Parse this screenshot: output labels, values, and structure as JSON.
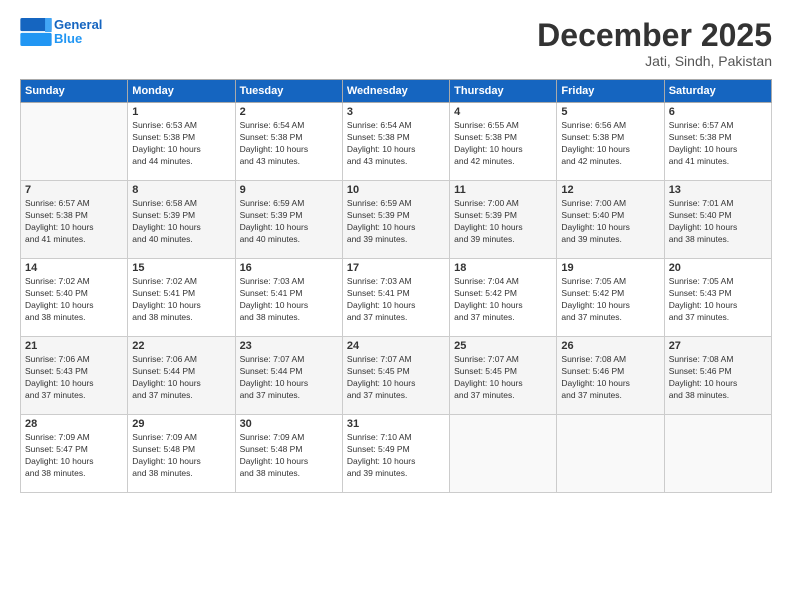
{
  "header": {
    "logo_line1": "General",
    "logo_line2": "Blue",
    "month": "December 2025",
    "location": "Jati, Sindh, Pakistan"
  },
  "weekdays": [
    "Sunday",
    "Monday",
    "Tuesday",
    "Wednesday",
    "Thursday",
    "Friday",
    "Saturday"
  ],
  "weeks": [
    [
      {
        "day": "",
        "info": ""
      },
      {
        "day": "1",
        "info": "Sunrise: 6:53 AM\nSunset: 5:38 PM\nDaylight: 10 hours\nand 44 minutes."
      },
      {
        "day": "2",
        "info": "Sunrise: 6:54 AM\nSunset: 5:38 PM\nDaylight: 10 hours\nand 43 minutes."
      },
      {
        "day": "3",
        "info": "Sunrise: 6:54 AM\nSunset: 5:38 PM\nDaylight: 10 hours\nand 43 minutes."
      },
      {
        "day": "4",
        "info": "Sunrise: 6:55 AM\nSunset: 5:38 PM\nDaylight: 10 hours\nand 42 minutes."
      },
      {
        "day": "5",
        "info": "Sunrise: 6:56 AM\nSunset: 5:38 PM\nDaylight: 10 hours\nand 42 minutes."
      },
      {
        "day": "6",
        "info": "Sunrise: 6:57 AM\nSunset: 5:38 PM\nDaylight: 10 hours\nand 41 minutes."
      }
    ],
    [
      {
        "day": "7",
        "info": "Sunrise: 6:57 AM\nSunset: 5:38 PM\nDaylight: 10 hours\nand 41 minutes."
      },
      {
        "day": "8",
        "info": "Sunrise: 6:58 AM\nSunset: 5:39 PM\nDaylight: 10 hours\nand 40 minutes."
      },
      {
        "day": "9",
        "info": "Sunrise: 6:59 AM\nSunset: 5:39 PM\nDaylight: 10 hours\nand 40 minutes."
      },
      {
        "day": "10",
        "info": "Sunrise: 6:59 AM\nSunset: 5:39 PM\nDaylight: 10 hours\nand 39 minutes."
      },
      {
        "day": "11",
        "info": "Sunrise: 7:00 AM\nSunset: 5:39 PM\nDaylight: 10 hours\nand 39 minutes."
      },
      {
        "day": "12",
        "info": "Sunrise: 7:00 AM\nSunset: 5:40 PM\nDaylight: 10 hours\nand 39 minutes."
      },
      {
        "day": "13",
        "info": "Sunrise: 7:01 AM\nSunset: 5:40 PM\nDaylight: 10 hours\nand 38 minutes."
      }
    ],
    [
      {
        "day": "14",
        "info": "Sunrise: 7:02 AM\nSunset: 5:40 PM\nDaylight: 10 hours\nand 38 minutes."
      },
      {
        "day": "15",
        "info": "Sunrise: 7:02 AM\nSunset: 5:41 PM\nDaylight: 10 hours\nand 38 minutes."
      },
      {
        "day": "16",
        "info": "Sunrise: 7:03 AM\nSunset: 5:41 PM\nDaylight: 10 hours\nand 38 minutes."
      },
      {
        "day": "17",
        "info": "Sunrise: 7:03 AM\nSunset: 5:41 PM\nDaylight: 10 hours\nand 37 minutes."
      },
      {
        "day": "18",
        "info": "Sunrise: 7:04 AM\nSunset: 5:42 PM\nDaylight: 10 hours\nand 37 minutes."
      },
      {
        "day": "19",
        "info": "Sunrise: 7:05 AM\nSunset: 5:42 PM\nDaylight: 10 hours\nand 37 minutes."
      },
      {
        "day": "20",
        "info": "Sunrise: 7:05 AM\nSunset: 5:43 PM\nDaylight: 10 hours\nand 37 minutes."
      }
    ],
    [
      {
        "day": "21",
        "info": "Sunrise: 7:06 AM\nSunset: 5:43 PM\nDaylight: 10 hours\nand 37 minutes."
      },
      {
        "day": "22",
        "info": "Sunrise: 7:06 AM\nSunset: 5:44 PM\nDaylight: 10 hours\nand 37 minutes."
      },
      {
        "day": "23",
        "info": "Sunrise: 7:07 AM\nSunset: 5:44 PM\nDaylight: 10 hours\nand 37 minutes."
      },
      {
        "day": "24",
        "info": "Sunrise: 7:07 AM\nSunset: 5:45 PM\nDaylight: 10 hours\nand 37 minutes."
      },
      {
        "day": "25",
        "info": "Sunrise: 7:07 AM\nSunset: 5:45 PM\nDaylight: 10 hours\nand 37 minutes."
      },
      {
        "day": "26",
        "info": "Sunrise: 7:08 AM\nSunset: 5:46 PM\nDaylight: 10 hours\nand 37 minutes."
      },
      {
        "day": "27",
        "info": "Sunrise: 7:08 AM\nSunset: 5:46 PM\nDaylight: 10 hours\nand 38 minutes."
      }
    ],
    [
      {
        "day": "28",
        "info": "Sunrise: 7:09 AM\nSunset: 5:47 PM\nDaylight: 10 hours\nand 38 minutes."
      },
      {
        "day": "29",
        "info": "Sunrise: 7:09 AM\nSunset: 5:48 PM\nDaylight: 10 hours\nand 38 minutes."
      },
      {
        "day": "30",
        "info": "Sunrise: 7:09 AM\nSunset: 5:48 PM\nDaylight: 10 hours\nand 38 minutes."
      },
      {
        "day": "31",
        "info": "Sunrise: 7:10 AM\nSunset: 5:49 PM\nDaylight: 10 hours\nand 39 minutes."
      },
      {
        "day": "",
        "info": ""
      },
      {
        "day": "",
        "info": ""
      },
      {
        "day": "",
        "info": ""
      }
    ]
  ]
}
